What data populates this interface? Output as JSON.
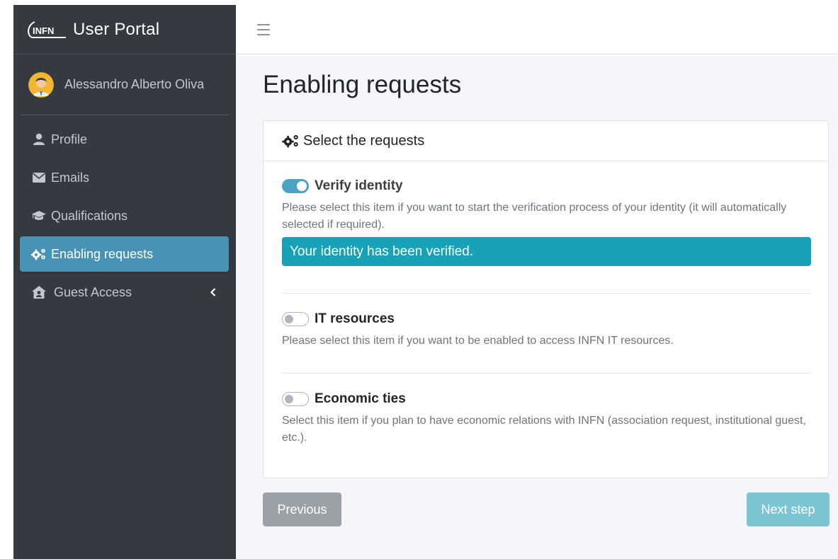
{
  "app": {
    "logo_text": "INFN",
    "title": "User Portal"
  },
  "user": {
    "name": "Alessandro Alberto Oliva"
  },
  "sidebar": {
    "items": [
      {
        "label": "Profile",
        "icon": "user-icon",
        "active": false
      },
      {
        "label": "Emails",
        "icon": "envelope-icon",
        "active": false
      },
      {
        "label": "Qualifications",
        "icon": "graduation-cap-icon",
        "active": false
      },
      {
        "label": "Enabling requests",
        "icon": "cogs-icon",
        "active": true
      },
      {
        "label": "Guest Access",
        "icon": "house-user-icon",
        "active": false,
        "expandable": true
      }
    ]
  },
  "topbar": {
    "menu_icon": "hamburger-icon"
  },
  "page": {
    "title": "Enabling requests"
  },
  "card": {
    "header": "Select the requests",
    "header_icon": "cogs-icon",
    "requests": [
      {
        "label": "Verify identity",
        "enabled": true,
        "description": "Please select this item if you want to start the verification process of your identity (it will automatically selected if required).",
        "status": "Your identity has been verified."
      },
      {
        "label": "IT resources",
        "enabled": false,
        "description": "Please select this item if you want to be enabled to access INFN IT resources."
      },
      {
        "label": "Economic ties",
        "enabled": false,
        "description": "Select this item if you plan to have economic relations with INFN (association request, institutional guest, etc.)."
      }
    ]
  },
  "buttons": {
    "previous": "Previous",
    "next": "Next step"
  },
  "colors": {
    "sidebar_bg": "#343a40",
    "active_item": "#4793b5",
    "verified_bg": "#17a2b8",
    "next_button": "#7bc4d4",
    "previous_button": "#9aa1a7"
  }
}
